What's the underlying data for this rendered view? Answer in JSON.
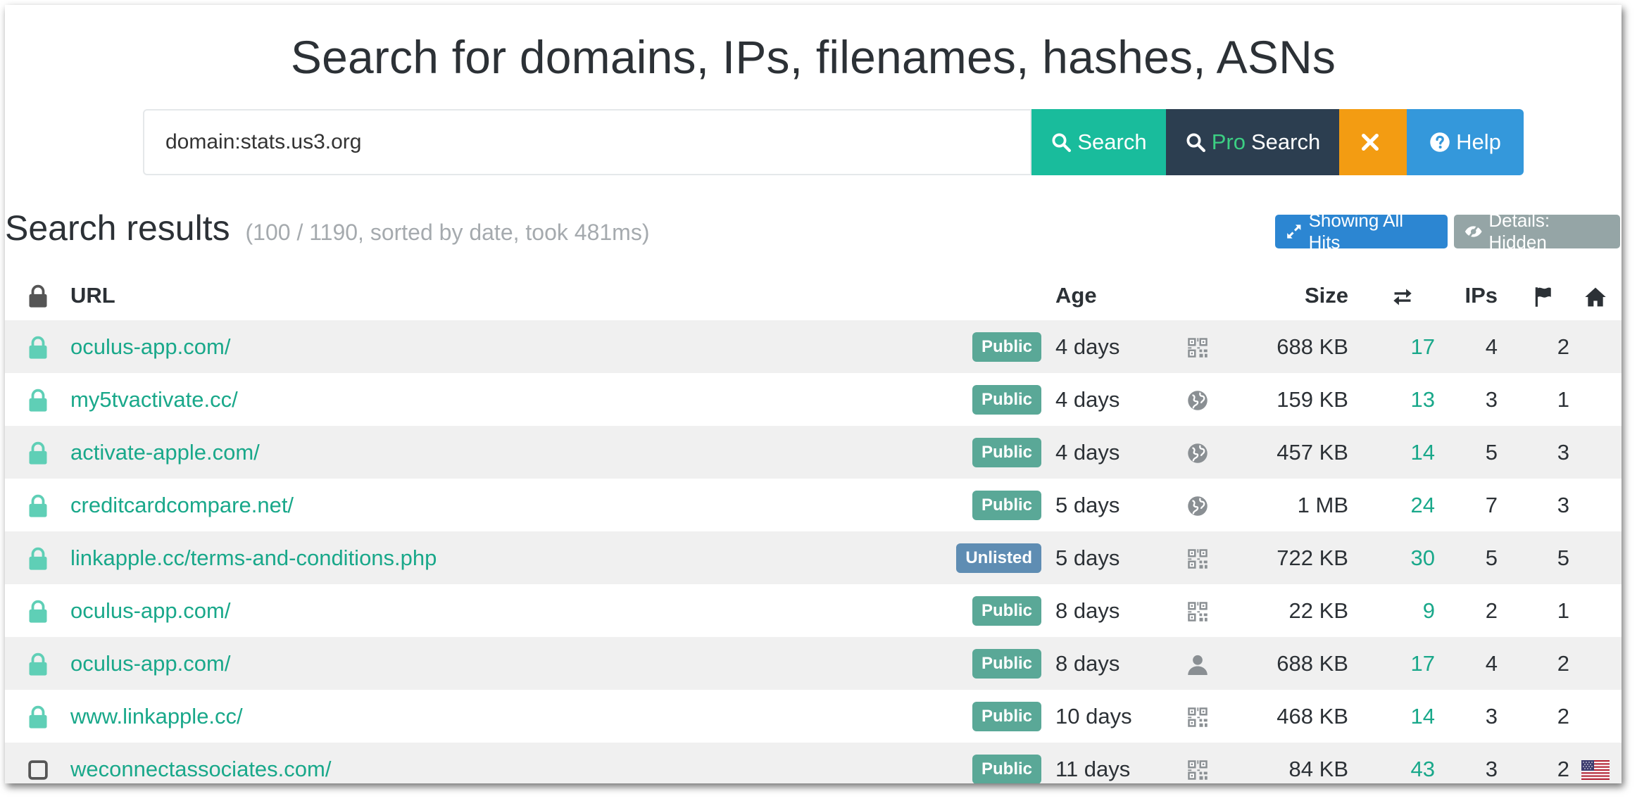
{
  "heading": "Search for domains, IPs, filenames, hashes, ASNs",
  "search": {
    "value": "domain:stats.us3.org",
    "search_label": "Search",
    "pro_prefix": "Pro",
    "pro_label": "Search",
    "clear_icon": "times-icon",
    "help_label": "Help"
  },
  "results": {
    "title": "Search results",
    "meta": "(100 / 1190, sorted by date, took 481ms)",
    "showing_all_hits": "Showing All Hits",
    "details_hidden": "Details: Hidden"
  },
  "table": {
    "headers": {
      "lock_icon": "lock-icon",
      "url": "URL",
      "age": "Age",
      "size": "Size",
      "requests_icon": "exchange-icon",
      "ips": "IPs",
      "flag_icon": "flag-icon",
      "home_icon": "home-icon"
    },
    "rows": [
      {
        "secure": true,
        "url": "oculus-app.com/",
        "visibility": "Public",
        "age": "4 days",
        "source_icon": "qrcode-icon",
        "size": "688 KB",
        "requests": "17",
        "ips": "4",
        "countries": "2",
        "country_flag": ""
      },
      {
        "secure": true,
        "url": "my5tvactivate.cc/",
        "visibility": "Public",
        "age": "4 days",
        "source_icon": "globe-icon",
        "size": "159 KB",
        "requests": "13",
        "ips": "3",
        "countries": "1",
        "country_flag": ""
      },
      {
        "secure": true,
        "url": "activate-apple.com/",
        "visibility": "Public",
        "age": "4 days",
        "source_icon": "globe-icon",
        "size": "457 KB",
        "requests": "14",
        "ips": "5",
        "countries": "3",
        "country_flag": ""
      },
      {
        "secure": true,
        "url": "creditcardcompare.net/",
        "visibility": "Public",
        "age": "5 days",
        "source_icon": "globe-icon",
        "size": "1 MB",
        "requests": "24",
        "ips": "7",
        "countries": "3",
        "country_flag": ""
      },
      {
        "secure": true,
        "url": "linkapple.cc/terms-and-conditions.php",
        "visibility": "Unlisted",
        "age": "5 days",
        "source_icon": "qrcode-icon",
        "size": "722 KB",
        "requests": "30",
        "ips": "5",
        "countries": "5",
        "country_flag": ""
      },
      {
        "secure": true,
        "url": "oculus-app.com/",
        "visibility": "Public",
        "age": "8 days",
        "source_icon": "qrcode-icon",
        "size": "22 KB",
        "requests": "9",
        "ips": "2",
        "countries": "1",
        "country_flag": ""
      },
      {
        "secure": true,
        "url": "oculus-app.com/",
        "visibility": "Public",
        "age": "8 days",
        "source_icon": "user-icon",
        "size": "688 KB",
        "requests": "17",
        "ips": "4",
        "countries": "2",
        "country_flag": ""
      },
      {
        "secure": true,
        "url": "www.linkapple.cc/",
        "visibility": "Public",
        "age": "10 days",
        "source_icon": "qrcode-icon",
        "size": "468 KB",
        "requests": "14",
        "ips": "3",
        "countries": "2",
        "country_flag": ""
      },
      {
        "secure": false,
        "url": "weconnectassociates.com/",
        "visibility": "Public",
        "age": "11 days",
        "source_icon": "qrcode-icon",
        "size": "84 KB",
        "requests": "43",
        "ips": "3",
        "countries": "2",
        "country_flag": "us-flag-icon"
      }
    ]
  },
  "colors": {
    "search": "#19bc9c",
    "pro_search": "#2c3e50",
    "clear": "#f39c12",
    "help": "#3498db",
    "link": "#19a88a",
    "badge_public": "#5aa897",
    "badge_unlisted": "#5f8db3"
  }
}
